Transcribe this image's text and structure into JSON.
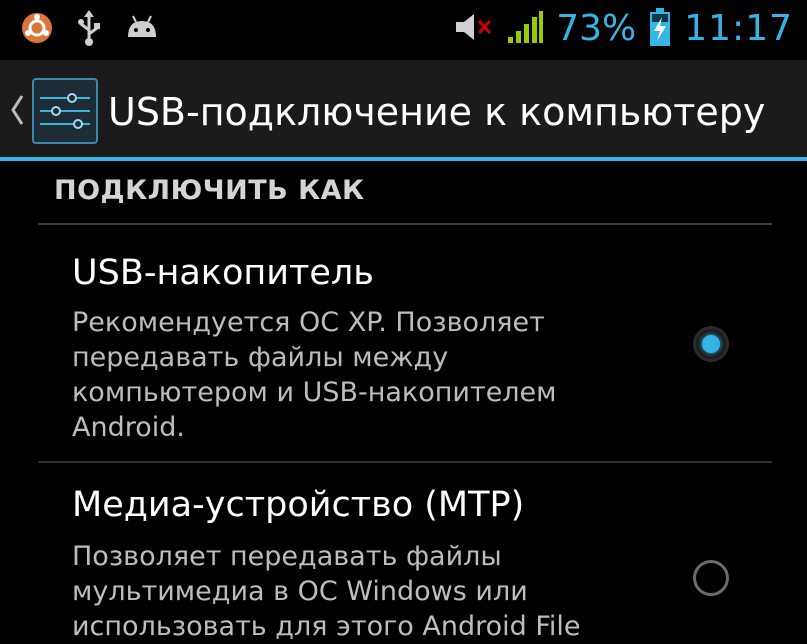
{
  "status_bar": {
    "battery_percent": "73%",
    "time": "11:17",
    "icons": [
      "ubuntu-icon",
      "usb-icon",
      "android-icon",
      "mute-icon",
      "signal-icon",
      "battery-charging-icon"
    ]
  },
  "action_bar": {
    "title": "USB-подключение к компьютеру"
  },
  "section": {
    "header": "ПОДКЛЮЧИТЬ КАК"
  },
  "options": [
    {
      "title": "USB-накопитель",
      "summary": "Рекомендуется ОС XP. Позволяет передавать файлы между компьютером и USB-накопителем Android.",
      "selected": true
    },
    {
      "title": "Медиа-устройство (MTP)",
      "summary": "Позволяет передавать файлы мультимедиа в ОС Windows или использовать для этого Android File",
      "selected": false
    }
  ],
  "colors": {
    "accent": "#33b5e5",
    "background": "#000000",
    "signal": "#99cc00",
    "mute": "#cc0000"
  }
}
